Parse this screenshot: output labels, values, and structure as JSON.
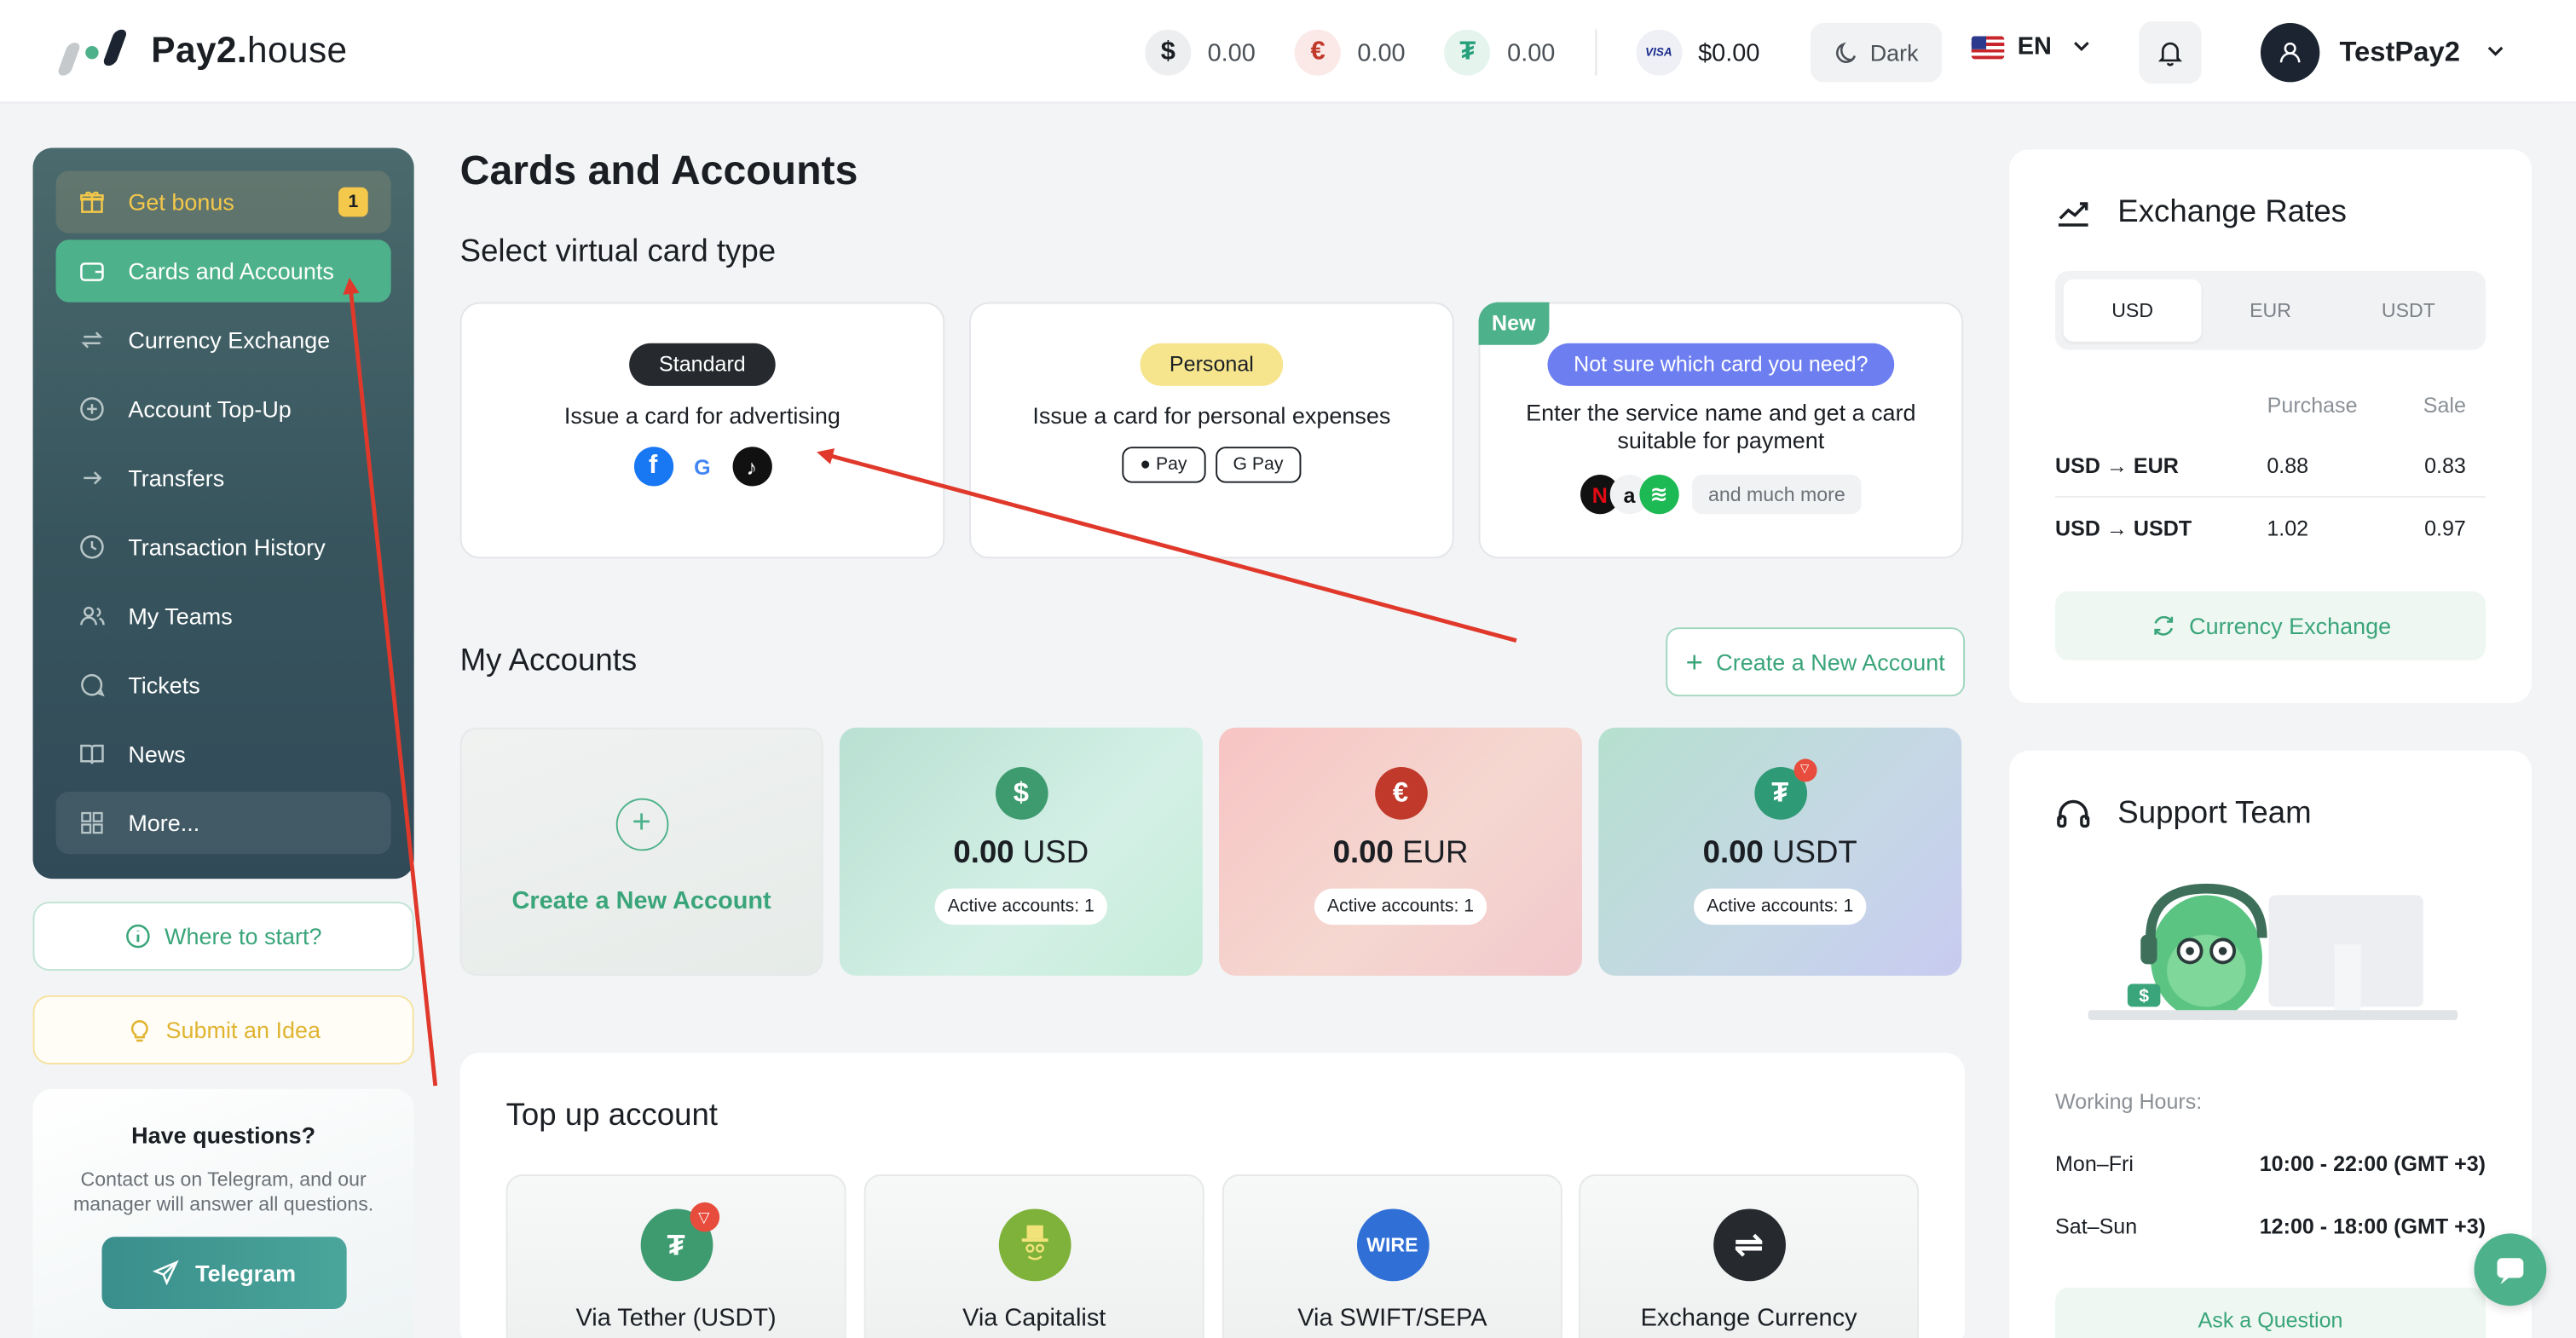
{
  "header": {
    "brand_bold": "Pay2.",
    "brand_light": "house",
    "balances": [
      {
        "symbol": "$",
        "value": "0.00",
        "color": "#1b1f24",
        "bg": "#eceef0"
      },
      {
        "symbol": "€",
        "value": "0.00",
        "color": "#c0392b",
        "bg": "#fbe9e7"
      },
      {
        "symbol": "₮",
        "value": "0.00",
        "color": "#26a17b",
        "bg": "#e6f4ee"
      }
    ],
    "visa_label": "VISA",
    "visa_balance": "$0.00",
    "theme_label": "Dark",
    "language": "EN",
    "user_name": "TestPay2"
  },
  "sidebar": {
    "items": [
      {
        "label": "Get bonus",
        "icon": "gift-icon",
        "badge": "1"
      },
      {
        "label": "Cards and Accounts",
        "icon": "wallet-icon"
      },
      {
        "label": "Currency Exchange",
        "icon": "exchange-icon"
      },
      {
        "label": "Account Top-Up",
        "icon": "plus-circle-icon"
      },
      {
        "label": "Transfers",
        "icon": "arrow-right-icon"
      },
      {
        "label": "Transaction History",
        "icon": "clock-icon"
      },
      {
        "label": "My Teams",
        "icon": "users-icon"
      },
      {
        "label": "Tickets",
        "icon": "chat-icon"
      },
      {
        "label": "News",
        "icon": "book-icon"
      },
      {
        "label": "More...",
        "icon": "grid-icon"
      }
    ],
    "where_to_start": "Where to start?",
    "submit_idea": "Submit an Idea",
    "questions_title": "Have questions?",
    "questions_text": "Contact us on Telegram, and our manager will answer all questions.",
    "telegram_label": "Telegram"
  },
  "main": {
    "title": "Cards and Accounts",
    "card_type_heading": "Select virtual card type",
    "card_types": [
      {
        "pill": "Standard",
        "text": "Issue a card for advertising"
      },
      {
        "pill": "Personal",
        "text": "Issue a card for personal expenses",
        "pay1": "Pay",
        "pay2": "G Pay"
      },
      {
        "tag": "New",
        "pill": "Not sure which card you need?",
        "text": "Enter the service name and get a card suitable for payment",
        "more": "and much more"
      }
    ],
    "accounts_heading": "My Accounts",
    "create_account_button": "Create a New Account",
    "accounts": [
      {
        "create_label": "Create a New Account"
      },
      {
        "symbol": "$",
        "amount": "0.00",
        "currency": "USD",
        "active": "Active accounts: 1"
      },
      {
        "symbol": "€",
        "amount": "0.00",
        "currency": "EUR",
        "active": "Active accounts: 1"
      },
      {
        "symbol": "₮",
        "amount": "0.00",
        "currency": "USDT",
        "active": "Active accounts: 1"
      }
    ],
    "topup_heading": "Top up account",
    "topup_methods": [
      {
        "label": "Via Tether (USDT)",
        "icon_text": "₮"
      },
      {
        "label": "Via Capitalist",
        "icon_text": ""
      },
      {
        "label": "Via SWIFT/SEPA",
        "icon_text": "WIRE"
      },
      {
        "label": "Exchange Currency",
        "icon_text": "⇌"
      }
    ]
  },
  "rates": {
    "title": "Exchange Rates",
    "tabs": [
      "USD",
      "EUR",
      "USDT"
    ],
    "selected_tab": "USD",
    "col_purchase": "Purchase",
    "col_sale": "Sale",
    "rows": [
      {
        "pair": "USD → EUR",
        "purchase": "0.88",
        "sale": "0.83"
      },
      {
        "pair": "USD → USDT",
        "purchase": "1.02",
        "sale": "0.97"
      }
    ],
    "exchange_button": "Currency Exchange"
  },
  "support": {
    "title": "Support Team",
    "working_hours_label": "Working Hours:",
    "hours": [
      {
        "days": "Mon–Fri",
        "time": "10:00 - 22:00 (GMT +3)"
      },
      {
        "days": "Sat–Sun",
        "time": "12:00 - 18:00 (GMT +3)"
      }
    ],
    "ask_button": "Ask a Question"
  },
  "colors": {
    "accent": "#4db28b",
    "annotation_arrow": "#e0392b",
    "sidebar_bg": "#3f5d63"
  }
}
